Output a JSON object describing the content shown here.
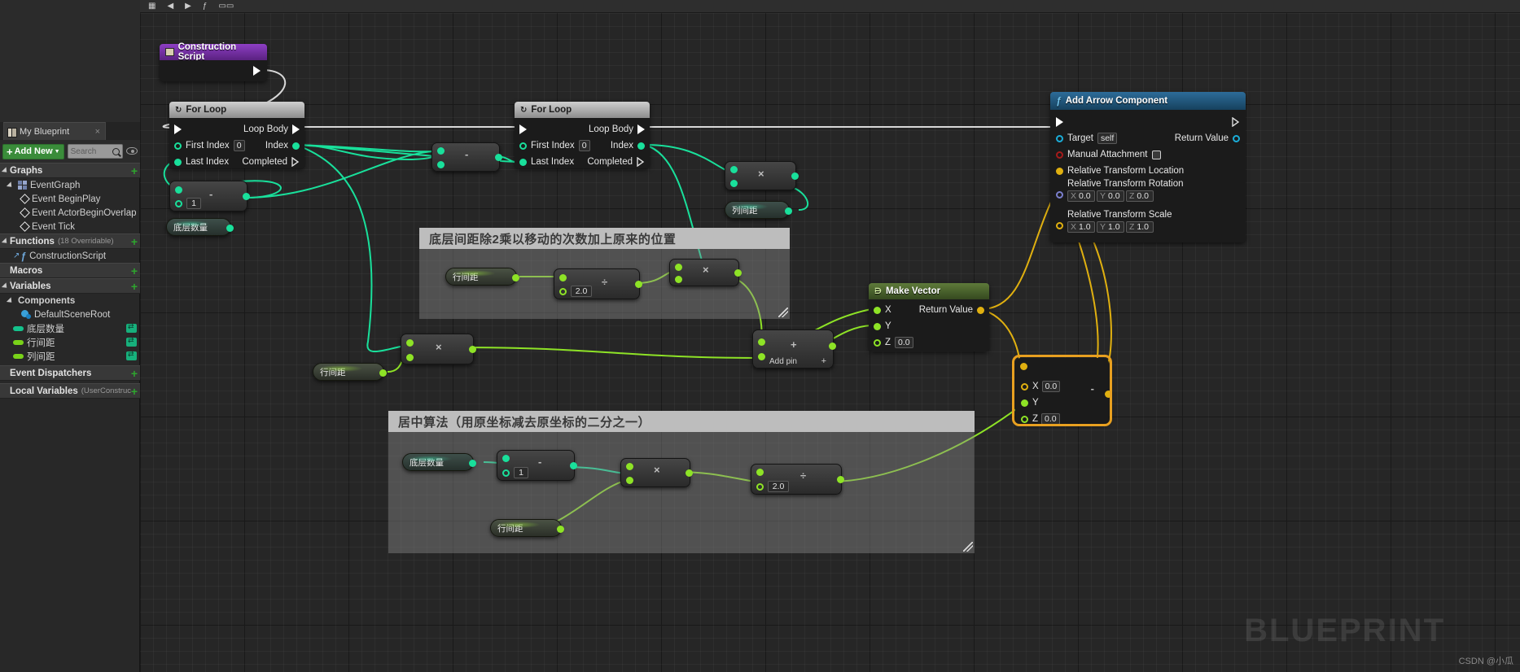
{
  "app": {
    "watermark": "BLUEPRINT",
    "credit": "CSDN @小瓜"
  },
  "left_panel": {
    "tab": {
      "label": "My Blueprint",
      "icon": "book-icon",
      "close": "×"
    },
    "toolbar": {
      "add_new_label": "Add New",
      "add_new_caret": "▼",
      "search_placeholder": "Search",
      "search_icon": "search-icon",
      "eye_icon": "eye-icon"
    },
    "sections": [
      {
        "label": "Graphs",
        "sub": "",
        "plus": "+"
      },
      {
        "label": "Functions",
        "sub": "(18 Overridable)",
        "plus": "+"
      },
      {
        "label": "Macros",
        "sub": "",
        "plus": "+"
      },
      {
        "label": "Variables",
        "sub": "",
        "plus": "+"
      },
      {
        "label": "Event Dispatchers",
        "sub": "",
        "plus": "+"
      },
      {
        "label": "Local Variables",
        "sub": "(UserConstruc",
        "plus": "+"
      }
    ],
    "graphs": {
      "event_graph": "EventGraph",
      "events": [
        "Event BeginPlay",
        "Event ActorBeginOverlap",
        "Event Tick"
      ]
    },
    "functions": {
      "items": [
        "ConstructionScript"
      ]
    },
    "variables": {
      "components_label": "Components",
      "component_items": [
        "DefaultSceneRoot"
      ],
      "var_items": [
        "底层数量",
        "行间距",
        "列间距"
      ]
    }
  },
  "graph": {
    "nodes": {
      "construction_script": {
        "title": "Construction Script"
      },
      "for_loop_1": {
        "title": "For Loop",
        "loop_body": "Loop Body",
        "first_index": "First Index",
        "first_index_value": "0",
        "last_index": "Last Index",
        "index": "Index",
        "completed": "Completed"
      },
      "for_loop_2": {
        "title": "For Loop",
        "loop_body": "Loop Body",
        "first_index": "First Index",
        "first_index_value": "0",
        "last_index": "Last Index",
        "index": "Index",
        "completed": "Completed"
      },
      "add_arrow_component": {
        "title": "Add Arrow Component",
        "target_label": "Target",
        "target_value": "self",
        "manual_attachment": "Manual Attachment",
        "rel_location": "Relative Transform Location",
        "rel_rotation": "Relative Transform Rotation",
        "rotation_values": {
          "x": "0.0",
          "y": "0.0",
          "z": "0.0"
        },
        "rel_scale": "Relative Transform Scale",
        "scale_values": {
          "x": "1.0",
          "y": "1.0",
          "z": "1.0"
        },
        "return_value": "Return Value",
        "axis_labels": {
          "x": "X",
          "y": "Y",
          "z": "Z"
        }
      },
      "make_vector": {
        "title": "Make Vector",
        "x": "X",
        "y": "Y",
        "z": "Z",
        "z_value": "0.0",
        "return_value": "Return Value"
      },
      "break_vector": {
        "x": "X",
        "x_value": "0.0",
        "y": "Y",
        "z": "Z",
        "z_value": "0.0",
        "op": "-"
      },
      "add_pin_node": {
        "op": "+",
        "add_pin": "Add pin"
      }
    },
    "getters": [
      {
        "name": "底层数量"
      },
      {
        "name": "列间距"
      },
      {
        "name": "行间距"
      },
      {
        "name": "行间距"
      },
      {
        "name": "行间距"
      },
      {
        "name": "底层数量"
      },
      {
        "name": "行间距"
      }
    ],
    "math_values": {
      "one_a": "1",
      "two_a": "2.0",
      "one_b": "1",
      "two_b": "2.0"
    },
    "operators": {
      "minus": "-",
      "multiply": "×",
      "divide": "÷",
      "plus": "+"
    },
    "comments": [
      {
        "text": "底层间距除2乘以移动的次数加上原来的位置"
      },
      {
        "text": "居中算法（用原坐标减去原坐标的二分之一）"
      }
    ]
  },
  "colors": {
    "exec_white": "#ffffff",
    "int_green": "#19e09b",
    "float_green": "#8ee326",
    "vector_gold": "#e0b010",
    "bool_red": "#a61b1b",
    "object_blue": "#1badd8",
    "rotator_purple": "#7b7fcd",
    "accent_selected": "#e8a020"
  }
}
